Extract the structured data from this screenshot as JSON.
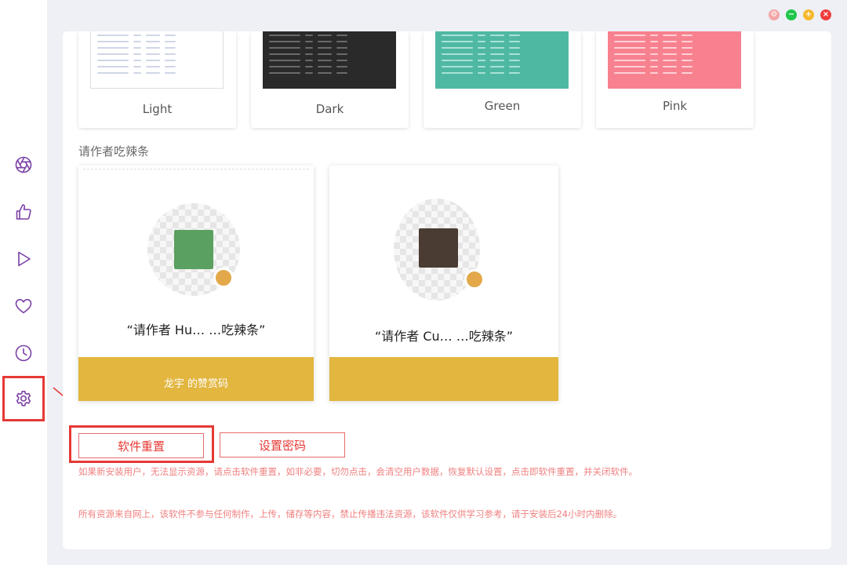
{
  "window_controls": [
    {
      "name": "settings",
      "color": "#f4a6a6",
      "glyph": "⚙"
    },
    {
      "name": "minimize",
      "color": "#1fc64b",
      "glyph": "−"
    },
    {
      "name": "maximize",
      "color": "#f5b82e",
      "glyph": "+"
    },
    {
      "name": "close",
      "color": "#ef3d3d",
      "glyph": "×"
    }
  ],
  "sidebar": {
    "items": [
      {
        "icon": "aperture-icon",
        "active": false
      },
      {
        "icon": "thumbs-up-icon",
        "active": false
      },
      {
        "icon": "play-icon",
        "active": false
      },
      {
        "icon": "heart-icon",
        "active": false
      },
      {
        "icon": "clock-icon",
        "active": false
      },
      {
        "icon": "gear-icon",
        "active": true
      }
    ],
    "accent": "#7b3fa6"
  },
  "themes": [
    {
      "label": "Light",
      "bg": "#ffffff",
      "line": "#cfd6e6"
    },
    {
      "label": "Dark",
      "bg": "#2a2a2a",
      "line": "#6a6a6a"
    },
    {
      "label": "Green",
      "bg": "#4fb8a3",
      "line": "#a9e2d6"
    },
    {
      "label": "Pink",
      "bg": "#f7818f",
      "line": "#ffd0d6"
    }
  ],
  "donate": {
    "section_title": "请作者吃辣条",
    "cards": [
      {
        "caption": "“请作者 Hu… …吃辣条”",
        "footer": "龙宇 的赞赏码",
        "qr_center": "#5aa060"
      },
      {
        "caption": "“请作者 Cu… …吃辣条”",
        "footer": "",
        "qr_center": "#4a3b33"
      }
    ],
    "gold": "#e2b63f"
  },
  "actions": {
    "reset_label": "软件重置",
    "password_label": "设置密码"
  },
  "notes": {
    "reset_note": "如果新安装用户，无法显示资源，请点击软件重置，如非必要，切勿点击，会清空用户数据，恢复默认设置，点击即软件重置，并关闭软件。",
    "disclaimer": "所有资源来自网上，该软件不参与任何制作，上传，储存等内容，禁止传播违法资源，该软件仅供学习参考，请于安装后24小时内删除。"
  }
}
